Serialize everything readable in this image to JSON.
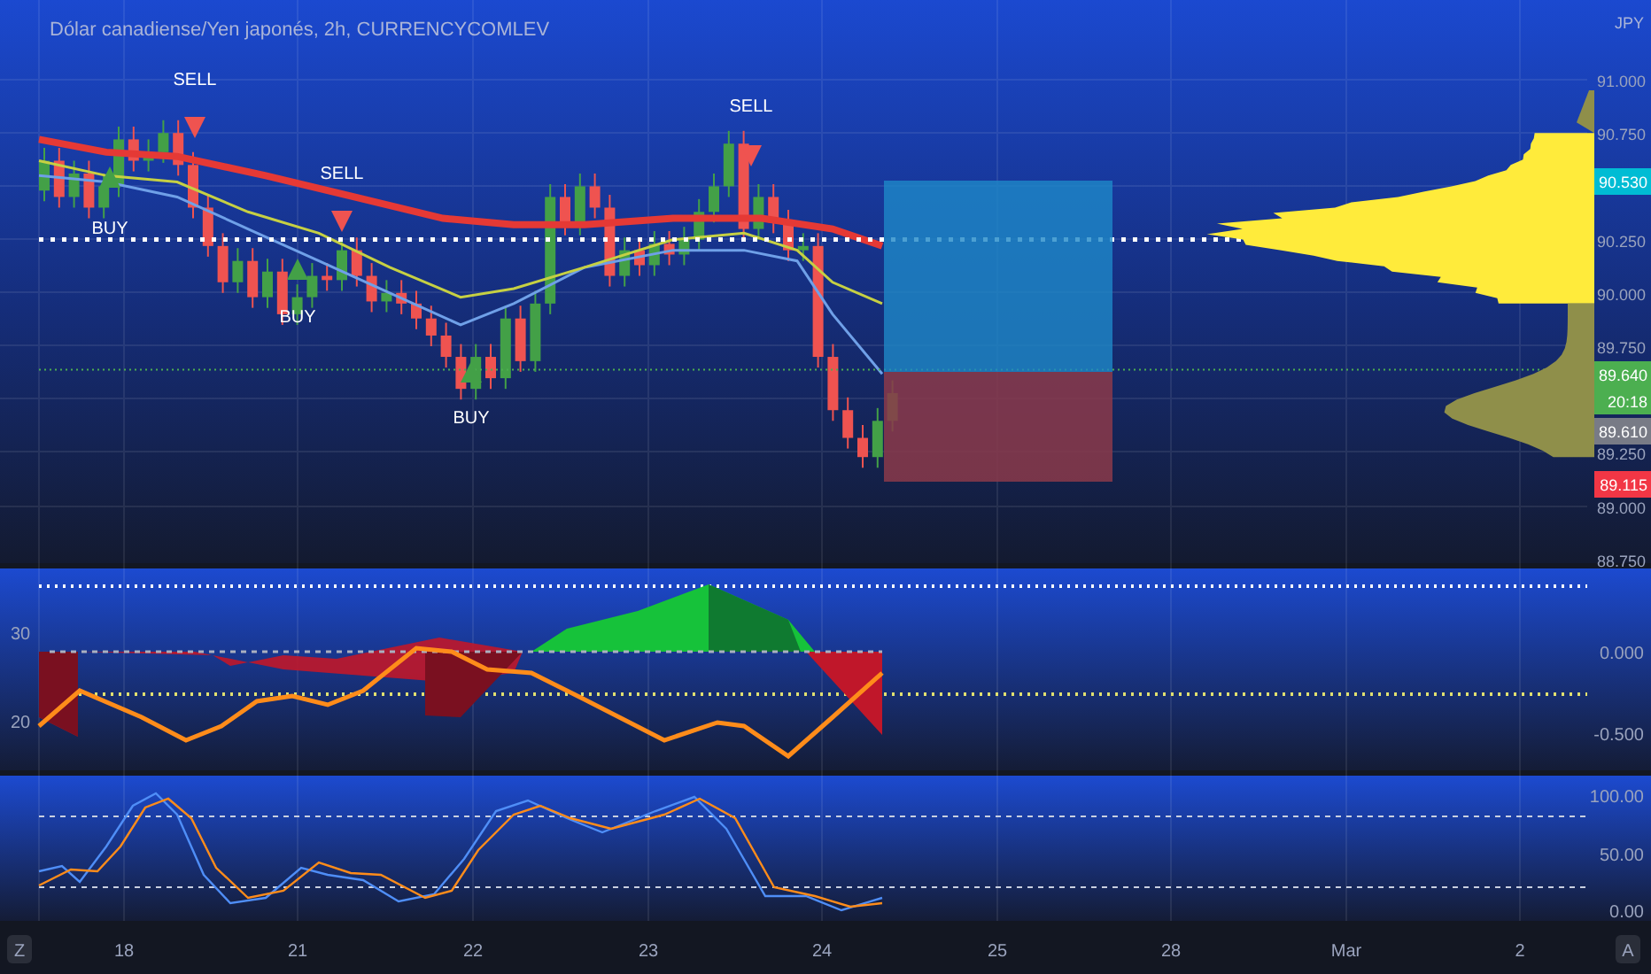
{
  "chart": {
    "title": "Dólar canadiense/Yen japonés, 2h, CURRENCYCOMLEV",
    "signals": [
      {
        "kind": "sell",
        "label": "SELL"
      },
      {
        "kind": "buy",
        "label": "BUY"
      },
      {
        "kind": "sell",
        "label": "SELL"
      },
      {
        "kind": "buy",
        "label": "BUY"
      },
      {
        "kind": "buy",
        "label": "BUY"
      },
      {
        "kind": "sell",
        "label": "SELL"
      }
    ]
  },
  "price_axis": {
    "currency": "JPY",
    "ticks": [
      "91.000",
      "90.750",
      "90.250",
      "90.000",
      "89.750",
      "89.250",
      "89.000",
      "88.750"
    ]
  },
  "price_badges": [
    {
      "lines": [
        "90.530"
      ],
      "color": "#00bcd4"
    },
    {
      "lines": [
        "89.640",
        "20:18"
      ],
      "color": "#4caf50"
    },
    {
      "lines": [
        "89.610"
      ],
      "color": "#787b86"
    },
    {
      "lines": [
        "89.115"
      ],
      "color": "#f23645"
    }
  ],
  "oscillator": {
    "left_ticks": [
      "30",
      "20"
    ],
    "right_ticks": [
      "0.000",
      "-0.500"
    ]
  },
  "stochastic": {
    "ticks": [
      "100.00",
      "50.00",
      "0.00"
    ]
  },
  "time_axis": {
    "labels": [
      "18",
      "21",
      "22",
      "23",
      "24",
      "25",
      "28",
      "Mar",
      "2"
    ],
    "left_button": "Z",
    "right_button": "A"
  }
}
